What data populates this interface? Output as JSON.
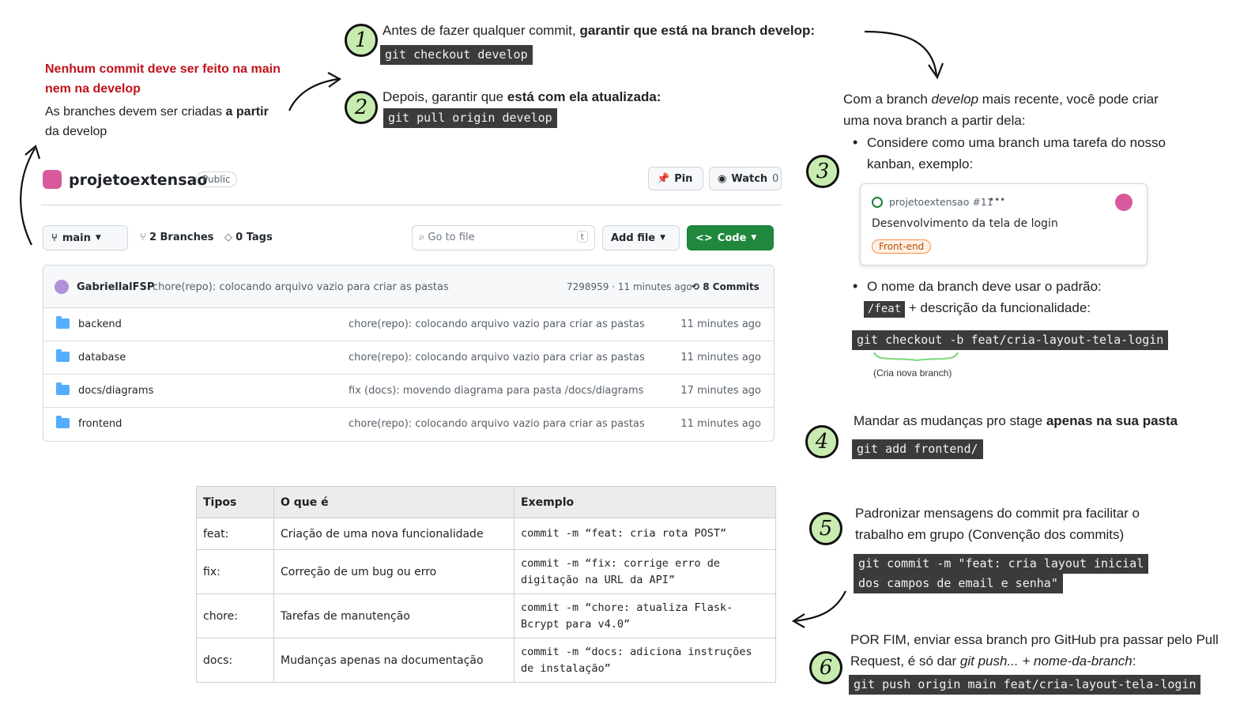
{
  "steps": {
    "s1": {
      "number": "1",
      "text_plain": "Antes de fazer qualquer commit, ",
      "text_bold": "garantir que está na branch develop:",
      "code": "git checkout develop"
    },
    "s2": {
      "number": "2",
      "text_plain": "Depois, garantir que ",
      "text_bold": "está com ela atualizada:",
      "code": "git pull origin develop"
    },
    "s3": {
      "number": "3",
      "intro_a": "Com a branch ",
      "intro_em": "develop",
      "intro_b": " mais recente, você pode criar uma nova branch a partir dela:",
      "bullet1": "Considere como uma branch uma tarefa do nosso kanban, exemplo:",
      "bullet2_a": "O nome da branch deve usar o padrão:",
      "bullet2_code": "/feat",
      "bullet2_b": " + descrição da funcionalidade:",
      "code": "git checkout -b feat/cria-layout-tela-login",
      "brace_note": "(Cria nova branch)"
    },
    "s4": {
      "number": "4",
      "text_plain": "Mandar as mudanças pro stage ",
      "text_bold": "apenas na sua pasta",
      "code": "git add frontend/"
    },
    "s5": {
      "number": "5",
      "text": "Padronizar mensagens do commit pra facilitar o trabalho em grupo (Convenção dos commits)",
      "code_line1": "git commit -m \"feat: cria layout inicial",
      "code_line2": "dos campos de email e senha\""
    },
    "s6": {
      "number": "6",
      "text_a": "POR FIM, enviar essa branch pro GitHub pra passar pelo Pull Request, é só dar ",
      "text_em1": "git push... + nome-da-branch",
      "text_b": ":",
      "code": "git push origin main feat/cria-layout-tela-login"
    }
  },
  "warning": {
    "line1": "Nenhum commit deve ser feito na main",
    "line2": "nem na develop",
    "body_plain": "As branches devem ser criadas ",
    "body_bold": "a partir",
    "body_end": "da develop"
  },
  "kanban": {
    "repo_ref": "projetoextensao #11",
    "dots": "•••",
    "title": "Desenvolvimento da tela de login",
    "label": "Front-end"
  },
  "github": {
    "repo_name": "projetoextensao",
    "visibility": "Public",
    "pin": "Pin",
    "watch": "Watch",
    "watch_count": "0",
    "branch": "main",
    "branches": "2 Branches",
    "tags": "0 Tags",
    "search_placeholder": "Go to file",
    "search_key": "t",
    "add_file": "Add file",
    "code": "Code",
    "last_commit": {
      "author": "GabriellalFSP",
      "message": "chore(repo): colocando arquivo vazio para criar as pastas",
      "hash_time": "7298959 · 11 minutes ago",
      "commits": "8 Commits"
    },
    "files": [
      {
        "name": "backend",
        "message": "chore(repo): colocando arquivo vazio para criar as pastas",
        "time": "11 minutes ago"
      },
      {
        "name": "database",
        "message": "chore(repo): colocando arquivo vazio para criar as pastas",
        "time": "11 minutes ago"
      },
      {
        "name": "docs/diagrams",
        "message": "fix (docs): movendo diagrama para pasta /docs/diagrams",
        "time": "17 minutes ago"
      },
      {
        "name": "frontend",
        "message": "chore(repo): colocando arquivo vazio para criar as pastas",
        "time": "11 minutes ago"
      }
    ]
  },
  "types_table": {
    "headers": [
      "Tipos",
      "O que é",
      "Exemplo"
    ],
    "rows": [
      {
        "type": "feat:",
        "what": "Criação de uma nova funcionalidade",
        "example": "commit -m “feat: cria rota POST”"
      },
      {
        "type": "fix:",
        "what": "Correção de um bug ou erro",
        "example": "commit -m “fix: corrige erro de digitação na URL da API”"
      },
      {
        "type": "chore:",
        "what": "Tarefas de manutenção",
        "example": "commit -m “chore: atualiza Flask-Bcrypt para v4.0”"
      },
      {
        "type": "docs:",
        "what": "Mudanças apenas na documentação",
        "example": "commit -m “docs: adiciona instruções de instalação”"
      }
    ]
  },
  "colors": {
    "step_circle": "#c8ecb0",
    "code_bg": "#3b3b3b",
    "warning": "#c0121b",
    "github_green": "#1f883d",
    "folder": "#54aeff"
  }
}
